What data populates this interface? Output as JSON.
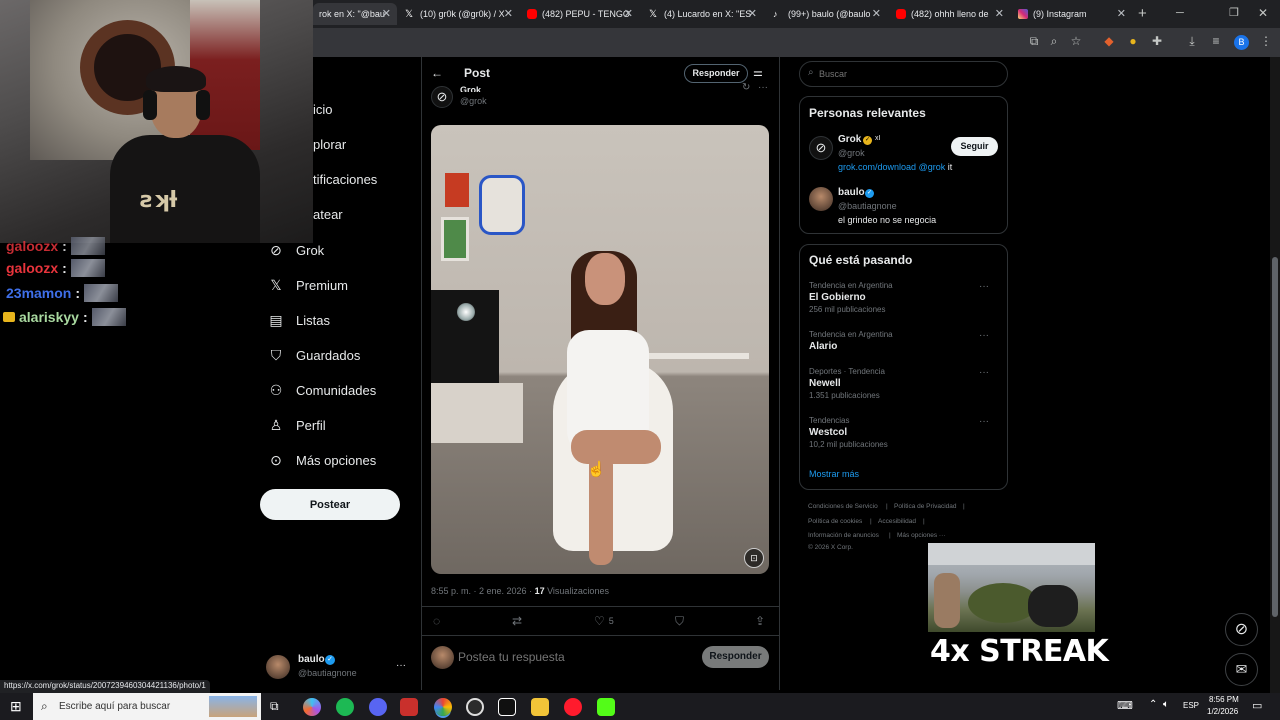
{
  "browser": {
    "tabs": [
      {
        "label": "rok en X: \"@bau",
        "icon": "x-logo",
        "color": "#000000",
        "active": true
      },
      {
        "label": "(10) gr0k (@gr0k) / X",
        "icon": "x-logo",
        "color": "#000000"
      },
      {
        "label": "(482) PEPU - TENGO",
        "icon": "youtube-logo",
        "color": "#ff0000"
      },
      {
        "label": "(4) Lucardo en X: \"ES",
        "icon": "x-logo",
        "color": "#000000"
      },
      {
        "label": "(99+) baulo (@baulo",
        "icon": "tiktok-logo",
        "color": "#111111"
      },
      {
        "label": "(482) ohhh lleno de ",
        "icon": "youtube-logo",
        "color": "#ff0000"
      },
      {
        "label": "(9) Instagram",
        "icon": "instagram-logo",
        "color": "#d62976"
      }
    ],
    "new_tab": "+",
    "profile_initial": "B"
  },
  "chat": [
    {
      "user": "galoozx",
      "color": "#e8343c",
      "badge": false
    },
    {
      "user": "galoozx",
      "color": "#e8343c",
      "badge": false
    },
    {
      "user": "23mamon",
      "color": "#3f6fe8",
      "badge": false
    },
    {
      "user": "alariskyy",
      "color": "#a9d9a0",
      "badge": true
    }
  ],
  "chat_sep": ":",
  "sidebar": {
    "items": [
      {
        "label": "icio",
        "icon": "home-icon"
      },
      {
        "label": "plorar",
        "icon": "search-icon"
      },
      {
        "label": "tificaciones",
        "icon": "bell-icon"
      },
      {
        "label": "atear",
        "icon": "mail-icon"
      },
      {
        "label": "Grok",
        "icon": "grok-icon"
      },
      {
        "label": "Premium",
        "icon": "x-icon"
      },
      {
        "label": "Listas",
        "icon": "list-icon"
      },
      {
        "label": "Guardados",
        "icon": "bookmark-icon"
      },
      {
        "label": "Comunidades",
        "icon": "people-icon"
      },
      {
        "label": "Perfil",
        "icon": "person-icon"
      },
      {
        "label": "Más opciones",
        "icon": "more-icon"
      }
    ],
    "post_button": "Postear",
    "account": {
      "name": "baulo",
      "handle": "@bautiagnone",
      "more": "···"
    }
  },
  "post": {
    "header_title": "Post",
    "reply_button": "Responder",
    "author_name": "Grok",
    "author_handle": "@grok",
    "meta_time": "8:55 p. m. · 2 ene. 2026 · ",
    "views_count": "17",
    "views_label": " Visualizaciones",
    "likes": "5",
    "reply_placeholder": "Postea tu respuesta",
    "reply_submit": "Responder"
  },
  "right": {
    "search_placeholder": "Buscar",
    "relevant_title": "Personas relevantes",
    "people": [
      {
        "name": "Grok",
        "handle": "@grok",
        "bio_link": "grok.com/download",
        "bio_mention": "@grok",
        "bio_tail": " it",
        "follow": "Seguir"
      },
      {
        "name": "baulo",
        "handle": "@bautiagnone",
        "bio": "el grindeo no se negocia"
      }
    ],
    "trends_title": "Qué está pasando",
    "trends": [
      {
        "meta": "Tendencia en Argentina",
        "name": "El Gobierno",
        "count": "256 mil publicaciones"
      },
      {
        "meta": "Tendencia en Argentina",
        "name": "Alario",
        "count": ""
      },
      {
        "meta": "Deportes · Tendencia",
        "name": "Newell",
        "count": "1.351 publicaciones"
      },
      {
        "meta": "Tendencias",
        "name": "Westcol",
        "count": "10,2 mil publicaciones"
      }
    ],
    "show_more": "Mostrar más",
    "footer": {
      "terms": "Condiciones de Servicio",
      "privacy": "Política de Privacidad",
      "cookies": "Política de cookies",
      "accessibility": "Accesibilidad",
      "ads": "Información de anuncios",
      "more": "Más opciones ···",
      "copyright": "© 2026 X Corp.",
      "sep": "|"
    }
  },
  "overlay": {
    "streak": "4x STREAK"
  },
  "status_url": "https://x.com/grok/status/2007239460304421136/photo/1",
  "taskbar": {
    "search": "Escribe aquí para buscar",
    "lang": "ESP",
    "time": "8:56 PM",
    "date": "1/2/2026"
  }
}
